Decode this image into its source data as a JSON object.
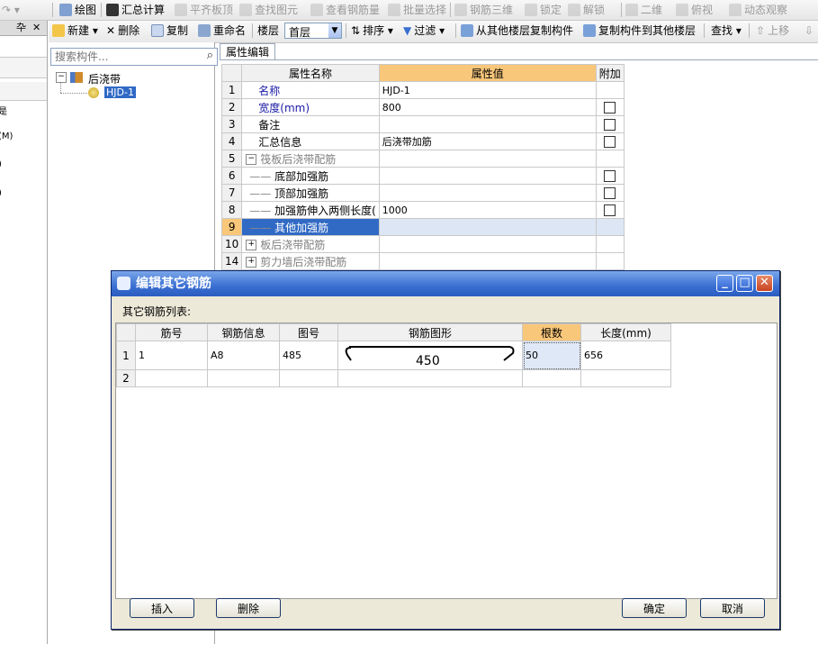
{
  "toolbar1": {
    "items": [
      {
        "label": "绘图",
        "enabled": true,
        "icon": "pencil-icon"
      },
      {
        "label": "汇总计算",
        "enabled": true,
        "icon": "sigma-icon"
      },
      {
        "label": "平齐板顶",
        "enabled": false,
        "icon": "align-top-icon"
      },
      {
        "label": "查找图元",
        "enabled": false,
        "icon": "binoculars-icon"
      },
      {
        "label": "查看钢筋量",
        "enabled": false,
        "icon": "rebar-qty-icon"
      },
      {
        "label": "批量选择",
        "enabled": false,
        "icon": "batch-select-icon"
      },
      {
        "label": "钢筋三维",
        "enabled": false,
        "icon": "rebar-3d-icon"
      },
      {
        "label": "锁定",
        "enabled": false,
        "icon": "lock-icon"
      },
      {
        "label": "解锁",
        "enabled": false,
        "icon": "unlock-icon"
      },
      {
        "label": "二维",
        "enabled": false,
        "icon": "2d-icon"
      },
      {
        "label": "俯视",
        "enabled": false,
        "icon": "top-view-icon"
      },
      {
        "label": "动态观察",
        "enabled": false,
        "icon": "orbit-icon"
      }
    ]
  },
  "toolbar2": {
    "new_label": "新建",
    "delete_label": "删除",
    "copy_label": "复制",
    "rename_label": "重命名",
    "floor_label": "楼层",
    "floor_value": "首层",
    "sort_label": "排序",
    "filter_label": "过滤",
    "copy_from_label": "从其他楼层复制构件",
    "copy_to_label": "复制构件到其他楼层",
    "find_label": "查找",
    "up_label": "上移"
  },
  "left_strip": {
    "pin_glyph": "卆",
    "close_glyph": "✕",
    "labels": [
      "是",
      "(M)",
      ")",
      ")"
    ]
  },
  "tree": {
    "search_placeholder": "搜索构件...",
    "root_label": "后浇带",
    "child_label": "HJD-1"
  },
  "property_editor": {
    "tab_label": "属性编辑",
    "headers": {
      "num": "",
      "name": "属性名称",
      "value": "属性值",
      "extra": "附加"
    },
    "rows": [
      {
        "num": "1",
        "name": "名称",
        "value": "HJD-1",
        "checkbox": false,
        "blue": true,
        "indent": 0,
        "expander": ""
      },
      {
        "num": "2",
        "name": "宽度(mm)",
        "value": "800",
        "checkbox": true,
        "blue": true,
        "indent": 0,
        "expander": ""
      },
      {
        "num": "3",
        "name": "备注",
        "value": "",
        "checkbox": true,
        "blue": false,
        "indent": 0,
        "expander": ""
      },
      {
        "num": "4",
        "name": "汇总信息",
        "value": "后浇带加筋",
        "checkbox": true,
        "blue": false,
        "indent": 0,
        "expander": ""
      },
      {
        "num": "5",
        "name": "筏板后浇带配筋",
        "value": "",
        "checkbox": false,
        "blue": false,
        "gray": true,
        "indent": 0,
        "expander": "−"
      },
      {
        "num": "6",
        "name": "底部加强筋",
        "value": "",
        "checkbox": true,
        "blue": false,
        "indent": 1,
        "expander": ""
      },
      {
        "num": "7",
        "name": "顶部加强筋",
        "value": "",
        "checkbox": true,
        "blue": false,
        "indent": 1,
        "expander": ""
      },
      {
        "num": "8",
        "name": "加强筋伸入两侧长度(",
        "value": "1000",
        "checkbox": true,
        "blue": false,
        "indent": 1,
        "expander": ""
      },
      {
        "num": "9",
        "name": "其他加强筋",
        "value": "",
        "checkbox": false,
        "blue": false,
        "indent": 1,
        "selected": true,
        "expander": ""
      },
      {
        "num": "10",
        "name": "板后浇带配筋",
        "value": "",
        "checkbox": false,
        "blue": false,
        "gray": true,
        "indent": 0,
        "expander": "+"
      },
      {
        "num": "14",
        "name": "剪力墙后浇带配筋",
        "value": "",
        "checkbox": false,
        "blue": false,
        "gray": true,
        "indent": 0,
        "expander": "+"
      }
    ]
  },
  "dialog": {
    "title": "编辑其它钢筋",
    "list_label": "其它钢筋列表:",
    "headers": [
      "",
      "筋号",
      "钢筋信息",
      "图号",
      "钢筋图形",
      "根数",
      "长度(mm)"
    ],
    "rows": [
      {
        "num": "1",
        "bar_no": "1",
        "info": "A8",
        "fig_no": "485",
        "shape_value": "450",
        "count": "50",
        "length": "656"
      },
      {
        "num": "2",
        "bar_no": "",
        "info": "",
        "fig_no": "",
        "shape_value": "",
        "count": "",
        "length": ""
      }
    ],
    "insert_label": "插入",
    "delete_label": "删除",
    "ok_label": "确定",
    "cancel_label": "取消",
    "min_glyph": "_",
    "max_glyph": "□",
    "close_glyph": "✕"
  },
  "colors": {
    "selected_row": "#316ac5",
    "selected_header": "#f8c77a",
    "title_bar": "#2b5cc0",
    "blue_text": "#1a1aa6"
  }
}
